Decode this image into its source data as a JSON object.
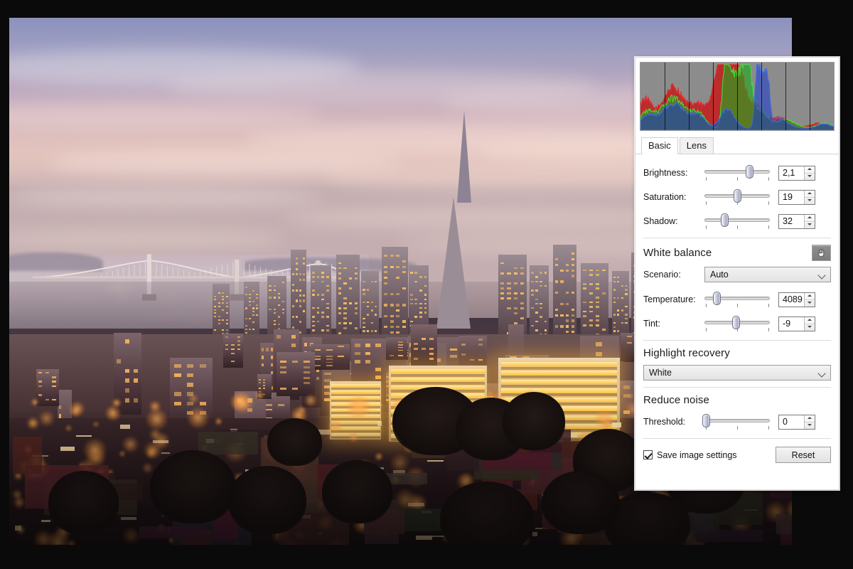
{
  "photo": {
    "alt_description": "San Francisco skyline at dusk with the Transamerica Pyramid and the Bay Bridge"
  },
  "panel": {
    "histogram": {
      "name": "rgb-histogram",
      "background": "#8c8c8c",
      "channels": [
        "red",
        "green",
        "blue"
      ],
      "divider_count": 7
    },
    "tabs": [
      {
        "label": "Basic",
        "active": true
      },
      {
        "label": "Lens",
        "active": false
      }
    ],
    "basic": {
      "brightness": {
        "label": "Brightness:",
        "value": "2,1",
        "handle_pct": 68
      },
      "saturation": {
        "label": "Saturation:",
        "value": "19",
        "handle_pct": 50
      },
      "shadow": {
        "label": "Shadow:",
        "value": "32",
        "handle_pct": 30
      }
    },
    "white_balance": {
      "title": "White balance",
      "picker_icon": "hand-icon",
      "scenario": {
        "label": "Scenario:",
        "value": "Auto"
      },
      "temperature": {
        "label": "Temperature:",
        "value": "4089",
        "handle_pct": 18
      },
      "tint": {
        "label": "Tint:",
        "value": "-9",
        "handle_pct": 48
      }
    },
    "highlight_recovery": {
      "title": "Highlight recovery",
      "value": "White"
    },
    "reduce_noise": {
      "title": "Reduce noise",
      "threshold": {
        "label": "Threshold:",
        "value": "0",
        "handle_pct": 2
      }
    },
    "footer": {
      "save_label": "Save image settings",
      "save_checked": true,
      "reset_label": "Reset"
    }
  }
}
